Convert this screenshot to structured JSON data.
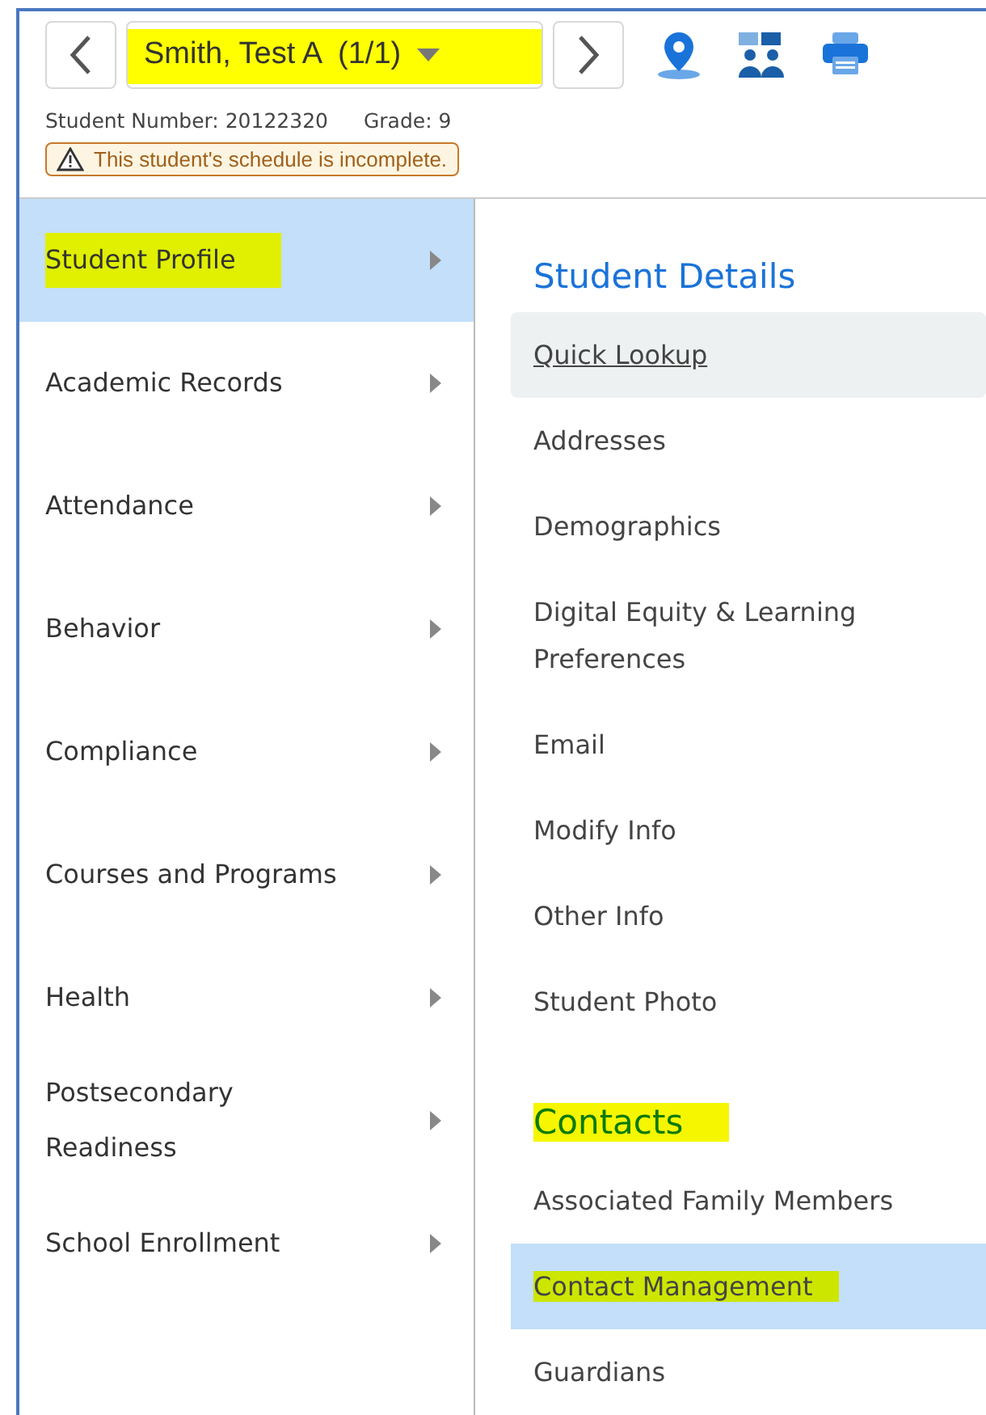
{
  "header": {
    "student_name": "Smith, Test A  (1/1)",
    "name_highlighted": true,
    "student_number": "Student Number: 20122320",
    "grade": "Grade: 9",
    "alert": "This student's schedule is incomplete."
  },
  "sidebar": {
    "items": [
      {
        "label": "Student Profile",
        "selected": true,
        "highlighted": true
      },
      {
        "label": "Academic Records",
        "selected": false,
        "highlighted": false
      },
      {
        "label": "Attendance",
        "selected": false,
        "highlighted": false
      },
      {
        "label": "Behavior",
        "selected": false,
        "highlighted": false
      },
      {
        "label": "Compliance",
        "selected": false,
        "highlighted": false
      },
      {
        "label": "Courses and Programs",
        "selected": false,
        "highlighted": false
      },
      {
        "label": "Health",
        "selected": false,
        "highlighted": false
      },
      {
        "label": "Postsecondary Readiness",
        "selected": false,
        "highlighted": false
      },
      {
        "label": "School Enrollment",
        "selected": false,
        "highlighted": false
      }
    ]
  },
  "sections": [
    {
      "title": "Student Details",
      "highlighted": false,
      "items": [
        {
          "label": "Quick Lookup",
          "selected": false,
          "hovered": true,
          "highlighted": false
        },
        {
          "label": "Addresses",
          "selected": false,
          "hovered": false,
          "highlighted": false
        },
        {
          "label": "Demographics",
          "selected": false,
          "hovered": false,
          "highlighted": false
        },
        {
          "label": "Digital Equity & Learning Preferences",
          "selected": false,
          "hovered": false,
          "highlighted": false
        },
        {
          "label": "Email",
          "selected": false,
          "hovered": false,
          "highlighted": false
        },
        {
          "label": "Modify Info",
          "selected": false,
          "hovered": false,
          "highlighted": false
        },
        {
          "label": "Other Info",
          "selected": false,
          "hovered": false,
          "highlighted": false
        },
        {
          "label": "Student Photo",
          "selected": false,
          "hovered": false,
          "highlighted": false
        }
      ]
    },
    {
      "title": "Contacts",
      "highlighted": true,
      "items": [
        {
          "label": "Associated Family Members",
          "selected": false,
          "hovered": false,
          "highlighted": false
        },
        {
          "label": "Contact Management",
          "selected": true,
          "hovered": false,
          "highlighted": true
        },
        {
          "label": "Guardians",
          "selected": false,
          "hovered": false,
          "highlighted": false
        }
      ]
    }
  ]
}
